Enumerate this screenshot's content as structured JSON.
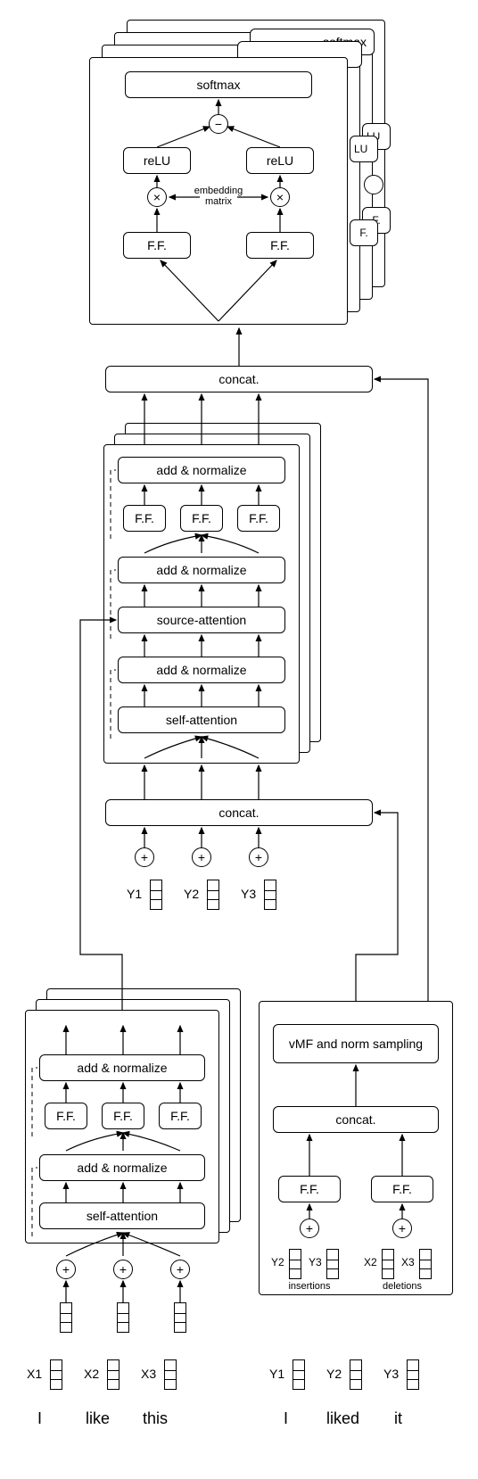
{
  "chart_data": {
    "type": "diagram",
    "description": "Neural network architecture diagram showing encoder-decoder transformer with diff-based output head and vMF sampling path",
    "modules": {
      "output_head": {
        "stack_count": 4,
        "top": "softmax",
        "subtract": "−",
        "relu_left": "reLU",
        "relu_right": "reLU",
        "multiply_left": "×",
        "multiply_right": "×",
        "embedding_label": "embedding\nmatrix",
        "ff_left": "F.F.",
        "ff_right": "F.F."
      },
      "concat_upper": "concat.",
      "decoder": {
        "stack_count": 3,
        "layers": [
          "add & normalize",
          [
            "F.F.",
            "F.F.",
            "F.F."
          ],
          "add & normalize",
          "source-attention",
          "add & normalize",
          "self-attention"
        ]
      },
      "concat_lower": "concat.",
      "y_inputs": [
        "Y1",
        "Y2",
        "Y3"
      ],
      "encoder": {
        "stack_count": 3,
        "layers": [
          "add & normalize",
          [
            "F.F.",
            "F.F.",
            "F.F."
          ],
          "add & normalize",
          "self-attention"
        ]
      },
      "vmf": {
        "sampling": "vMF and norm\nsampling",
        "concat": "concat.",
        "ff_left": "F.F.",
        "ff_right": "F.F.",
        "insertions_vecs": [
          "Y2",
          "Y3"
        ],
        "insertions_label": "insertions",
        "deletions_vecs": [
          "X2",
          "X3"
        ],
        "deletions_label": "deletions"
      },
      "x_inputs": [
        "X1",
        "X2",
        "X3"
      ],
      "x_words": [
        "I",
        "like",
        "this"
      ],
      "y_outputs": [
        "Y1",
        "Y2",
        "Y3"
      ],
      "y_words": [
        "I",
        "liked",
        "it"
      ]
    }
  },
  "labels": {
    "softmax": "softmax",
    "relu": "reLU",
    "embedding": "embedding matrix",
    "ff": "F.F.",
    "concat": "concat.",
    "addnorm": "add & normalize",
    "srcattn": "source-attention",
    "selfattn": "self-attention",
    "vmf": "vMF and norm sampling",
    "insertions": "insertions",
    "deletions": "deletions",
    "Y1": "Y1",
    "Y2": "Y2",
    "Y3": "Y3",
    "X1": "X1",
    "X2": "X2",
    "X3": "X3",
    "w_I": "I",
    "w_like": "like",
    "w_this": "this",
    "w_liked": "liked",
    "w_it": "it",
    "plus": "+",
    "times": "×",
    "minus": "−"
  }
}
